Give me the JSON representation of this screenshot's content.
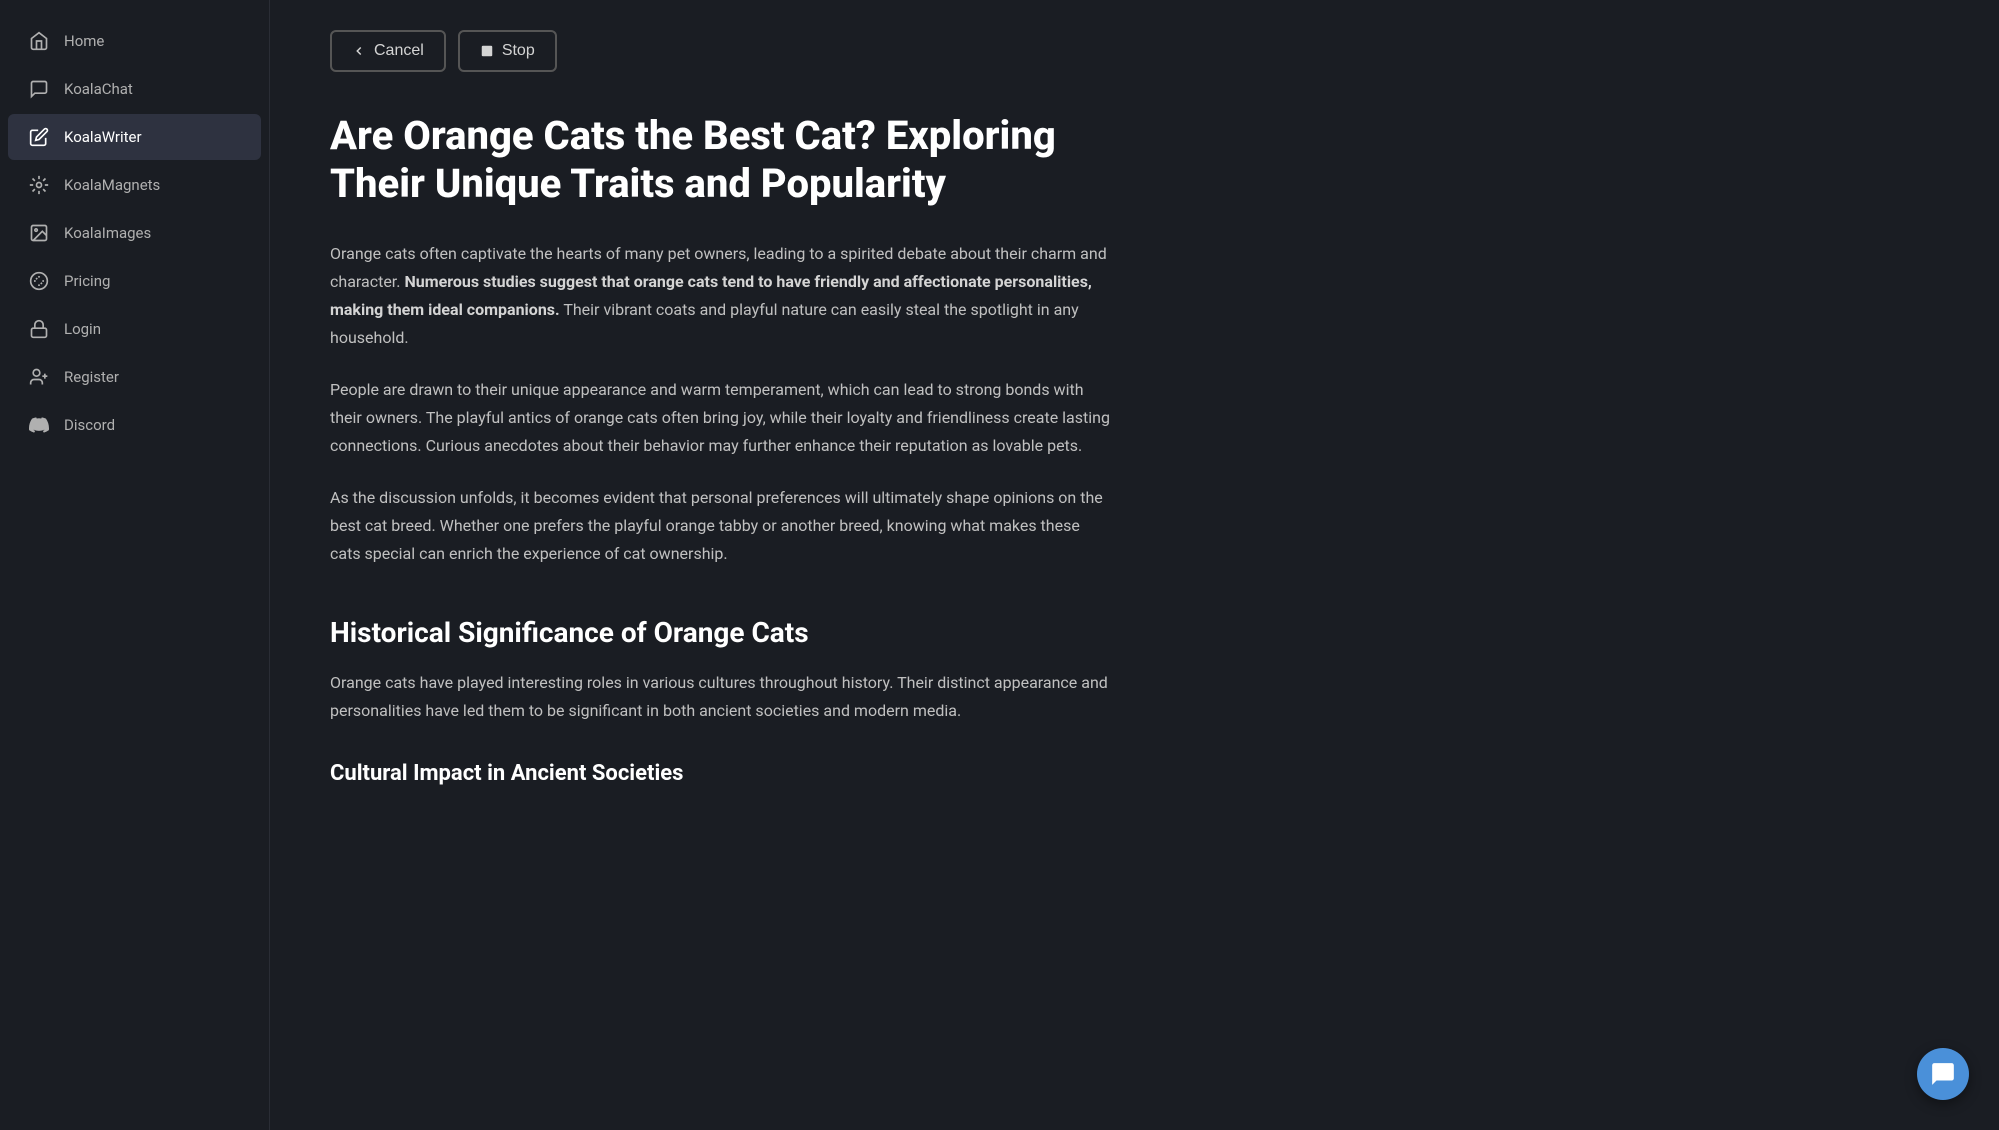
{
  "sidebar": {
    "items": [
      {
        "label": "Home",
        "icon": "home-icon",
        "active": false
      },
      {
        "label": "KoalaChat",
        "icon": "chat-icon",
        "active": false
      },
      {
        "label": "KoalaWriter",
        "icon": "writer-icon",
        "active": true
      },
      {
        "label": "KoalaMagnets",
        "icon": "magnets-icon",
        "active": false
      },
      {
        "label": "KoalaImages",
        "icon": "images-icon",
        "active": false
      },
      {
        "label": "Pricing",
        "icon": "pricing-icon",
        "active": false
      },
      {
        "label": "Login",
        "icon": "login-icon",
        "active": false
      },
      {
        "label": "Register",
        "icon": "register-icon",
        "active": false
      },
      {
        "label": "Discord",
        "icon": "discord-icon",
        "active": false
      }
    ]
  },
  "toolbar": {
    "cancel_label": "Cancel",
    "stop_label": "Stop"
  },
  "article": {
    "title": "Are Orange Cats the Best Cat? Exploring Their Unique Traits and Popularity",
    "paragraphs": [
      {
        "text_before_bold": "Orange cats often captivate the hearts of many pet owners, leading to a spirited debate about their charm and character. ",
        "bold_text": "Numerous studies suggest that orange cats tend to have friendly and affectionate personalities, making them ideal companions.",
        "text_after_bold": " Their vibrant coats and playful nature can easily steal the spotlight in any household."
      }
    ],
    "paragraph2": "People are drawn to their unique appearance and warm temperament, which can lead to strong bonds with their owners. The playful antics of orange cats often bring joy, while their loyalty and friendliness create lasting connections. Curious anecdotes about their behavior may further enhance their reputation as lovable pets.",
    "paragraph3": "As the discussion unfolds, it becomes evident that personal preferences will ultimately shape opinions on the best cat breed. Whether one prefers the playful orange tabby or another breed, knowing what makes these cats special can enrich the experience of cat ownership.",
    "section1_title": "Historical Significance of Orange Cats",
    "section1_paragraph": "Orange cats have played interesting roles in various cultures throughout history. Their distinct appearance and personalities have led them to be significant in both ancient societies and modern media.",
    "subsection1_title": "Cultural Impact in Ancient Societies"
  }
}
